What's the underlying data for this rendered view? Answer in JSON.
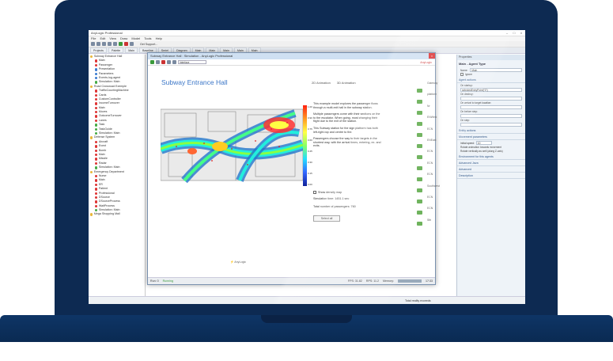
{
  "app": {
    "title": "AnyLogic Professional",
    "menu": [
      "File",
      "Edit",
      "View",
      "Draw",
      "Model",
      "Tools",
      "Help"
    ],
    "support_label": "Get Support..."
  },
  "tabs": [
    "Projects",
    "Palette",
    "Main",
    "Baseline",
    "Seriel",
    "Diagram",
    "Main",
    "Main",
    "Main",
    "Main",
    "Main",
    "Main",
    "Main"
  ],
  "project_tree": [
    {
      "label": "Subway Entrance Hall",
      "icon": "y"
    },
    {
      "label": "Main",
      "icon": "r"
    },
    {
      "label": "Passenger",
      "icon": "r"
    },
    {
      "label": "Presentation",
      "icon": "b"
    },
    {
      "label": "Parameters",
      "icon": "b"
    },
    {
      "label": "Events-log-agent",
      "icon": "b"
    },
    {
      "label": "Simulation: Main",
      "icon": "g"
    },
    {
      "label": "Road Crossroad Exemple",
      "icon": "y"
    },
    {
      "label": "TrafficCountingMachine",
      "icon": "r"
    },
    {
      "label": "Cards",
      "icon": "r"
    },
    {
      "label": "CustomController",
      "icon": "r"
    },
    {
      "label": "IncomeTurnover",
      "icon": "r"
    },
    {
      "label": "Main",
      "icon": "r"
    },
    {
      "label": "Moves",
      "icon": "r"
    },
    {
      "label": "OutcomeTurnover",
      "icon": "r"
    },
    {
      "label": "Lanes",
      "icon": "r"
    },
    {
      "label": "Task",
      "icon": "g"
    },
    {
      "label": "TaskGuide",
      "icon": "g"
    },
    {
      "label": "Simulation: Main",
      "icon": "g"
    },
    {
      "label": "Defense System",
      "icon": "y"
    },
    {
      "label": "Aircraft",
      "icon": "r"
    },
    {
      "label": "Event",
      "icon": "r"
    },
    {
      "label": "Bomb",
      "icon": "r"
    },
    {
      "label": "Main",
      "icon": "r"
    },
    {
      "label": "Missile",
      "icon": "r"
    },
    {
      "label": "Radar",
      "icon": "r"
    },
    {
      "label": "Simulation: Main",
      "icon": "g"
    },
    {
      "label": "Emergency Department",
      "icon": "y"
    },
    {
      "label": "Nurse",
      "icon": "r"
    },
    {
      "label": "Main",
      "icon": "r"
    },
    {
      "label": "ER",
      "icon": "r"
    },
    {
      "label": "Patient",
      "icon": "r"
    },
    {
      "label": "Professional",
      "icon": "r"
    },
    {
      "label": "DSource",
      "icon": "r"
    },
    {
      "label": "DSourceProcess",
      "icon": "r"
    },
    {
      "label": "WaitProcess",
      "icon": "r"
    },
    {
      "label": "Simulation: Main",
      "icon": "g"
    },
    {
      "label": "Mega Shopping Mall",
      "icon": "y"
    }
  ],
  "sim_window": {
    "title": "Subway Entrance Hall : Simulation - AnyLogic Professional",
    "dropdown": "Interface",
    "hall_title": "Subway Entrance Hall",
    "tabs": [
      "2D Animation",
      "3D Animation"
    ],
    "description": [
      "This example model explores the passenger flows through a multi-exit hall in the subway station.",
      "Multiple passengers come with their sections on the to the escalator. When going, most changing their flight due to the exit of the station.",
      "This Subway station for the sign platform has both left-right-top and centre to the.",
      "Passengers choose the way to their targets in the shortest way, with the arrival times, entering, ex. and exits."
    ],
    "legend_labels": [
      "1.00",
      "0.90",
      "0.75",
      "0.60",
      "0.45",
      "0.30",
      "0.15",
      "0.00"
    ],
    "checkbox_label": "Show density map",
    "duration_text": "Simulation time: 1451.1 sec",
    "total_text": "Total number of passengers: 760",
    "button_label": "Select all",
    "brand": "AnyLogic",
    "side_labels": [
      "Gateway",
      "platform",
      "Nr",
      "ENWest",
      "ECN",
      "ENEast",
      "ECN",
      "ECN",
      "ECN",
      "Southwest",
      "ECN",
      "ECN",
      "Sth"
    ],
    "status": {
      "run": "Run: 0",
      "state": "Running",
      "fps": "FPS: 31.82",
      "rps": "RPS: 11.2",
      "memory": "Memory:",
      "time": "17:33"
    }
  },
  "properties": {
    "header": "Properties",
    "title": "Main - Agent Type",
    "name_label": "Name:",
    "name_value": "Main",
    "ignore_label": "Ignore",
    "sections": [
      "Agent actions",
      "Entity actions",
      "Movement parameters",
      "Environment for this agents",
      "Advanced Java",
      "Advanced",
      "Description"
    ],
    "fields": [
      {
        "label": "On startup:",
        "value": "selectedEntryPoint(\"0\")"
      },
      {
        "label": "On destroy:",
        "value": ""
      },
      {
        "label": "On arrival to target location:",
        "value": ""
      },
      {
        "label": "On before step:",
        "value": ""
      },
      {
        "label": "On step:",
        "value": ""
      }
    ],
    "initial_speed_label": "Initial speed:",
    "initial_speed_value": "10",
    "rotate_label": "Rotate animation towards movement",
    "rotate2_label": "Rotate vertically as well (along Z-axis)"
  },
  "footer_status": "Total reality exceeds"
}
